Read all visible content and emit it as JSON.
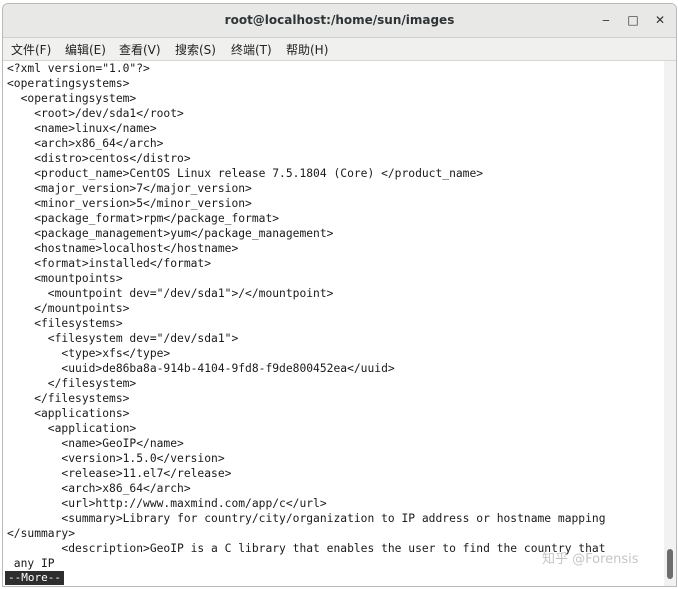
{
  "window": {
    "title": "root@localhost:/home/sun/images",
    "minimize_glyph": "‒",
    "maximize_glyph": "□",
    "close_glyph": "✕"
  },
  "menu": [
    {
      "label": "文件(F)"
    },
    {
      "label": "编辑(E)"
    },
    {
      "label": "查看(V)"
    },
    {
      "label": "搜索(S)"
    },
    {
      "label": "终端(T)"
    },
    {
      "label": "帮助(H)"
    }
  ],
  "terminal": {
    "lines": [
      "<?xml version=\"1.0\"?>",
      "<operatingsystems>",
      "  <operatingsystem>",
      "    <root>/dev/sda1</root>",
      "    <name>linux</name>",
      "    <arch>x86_64</arch>",
      "    <distro>centos</distro>",
      "    <product_name>CentOS Linux release 7.5.1804 (Core) </product_name>",
      "    <major_version>7</major_version>",
      "    <minor_version>5</minor_version>",
      "    <package_format>rpm</package_format>",
      "    <package_management>yum</package_management>",
      "    <hostname>localhost</hostname>",
      "    <format>installed</format>",
      "    <mountpoints>",
      "      <mountpoint dev=\"/dev/sda1\">/</mountpoint>",
      "    </mountpoints>",
      "    <filesystems>",
      "      <filesystem dev=\"/dev/sda1\">",
      "        <type>xfs</type>",
      "        <uuid>de86ba8a-914b-4104-9fd8-f9de800452ea</uuid>",
      "      </filesystem>",
      "    </filesystems>",
      "    <applications>",
      "      <application>",
      "        <name>GeoIP</name>",
      "        <version>1.5.0</version>",
      "        <release>11.el7</release>",
      "        <arch>x86_64</arch>",
      "        <url>http://www.maxmind.com/app/c</url>",
      "        <summary>Library for country/city/organization to IP address or hostname mapping",
      "</summary>",
      "        <description>GeoIP is a C library that enables the user to find the country that",
      " any IP"
    ],
    "pager_prompt": "--More--"
  },
  "watermark": "知乎 @Forensis"
}
